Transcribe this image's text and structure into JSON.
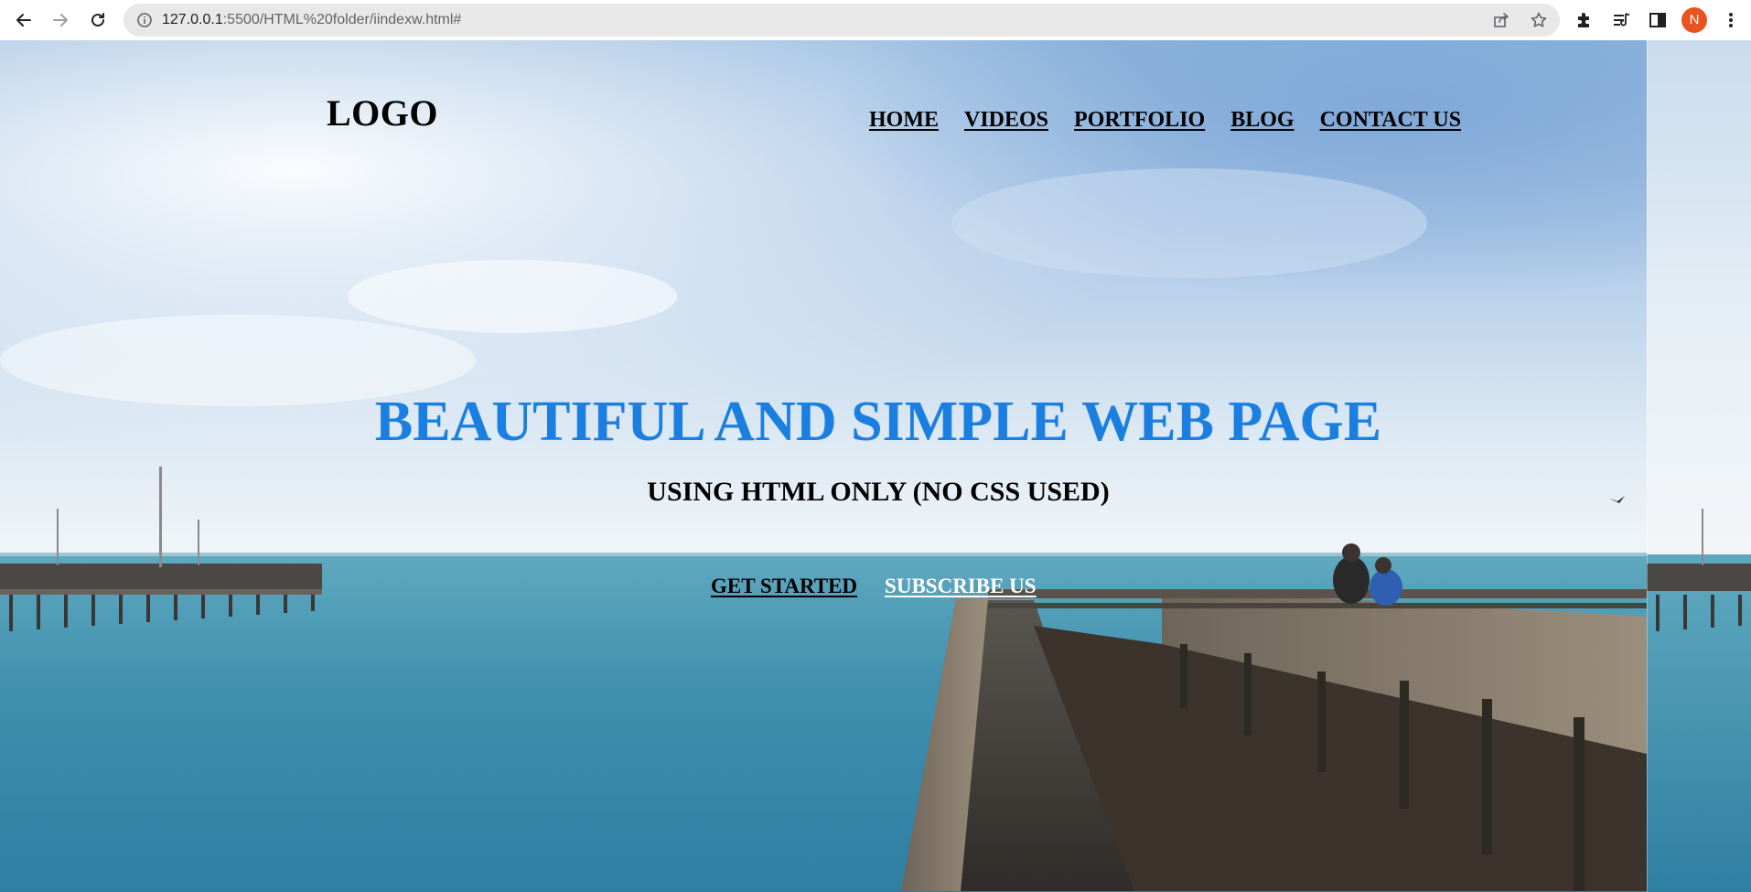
{
  "browser": {
    "url_host": "127.0.0.1",
    "url_rest": ":5500/HTML%20folder/iindexw.html#",
    "profile_initial": "N",
    "profile_color": "#e8541f"
  },
  "page": {
    "logo": "LOGO",
    "nav": [
      {
        "label": "HOME"
      },
      {
        "label": "VIDEOS"
      },
      {
        "label": "PORTFOLIO"
      },
      {
        "label": "BLOG"
      },
      {
        "label": "CONTACT US"
      }
    ],
    "hero": {
      "title": "BEAUTIFUL AND SIMPLE WEB PAGE",
      "title_color": "#1a7fe0",
      "subtitle": "USING HTML ONLY (NO CSS USED)"
    },
    "buttons": {
      "get_started": "GET STARTED ",
      "subscribe": "SUBSCRIBE US"
    }
  },
  "icons": {
    "back": "arrow-left-icon",
    "forward": "arrow-right-icon",
    "reload": "reload-icon",
    "site_info": "info-icon",
    "share": "share-icon",
    "bookmark": "star-icon",
    "extensions": "puzzle-icon",
    "reading_list": "reading-list-icon",
    "side_panel": "side-panel-icon",
    "menu": "kebab-menu-icon"
  }
}
